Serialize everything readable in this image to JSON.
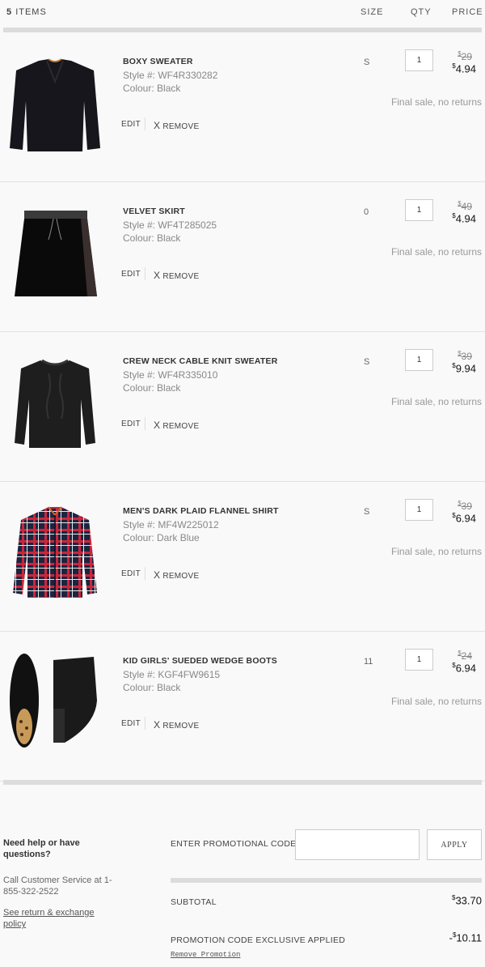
{
  "header": {
    "count": "5",
    "items_label": "ITEMS",
    "size_label": "SIZE",
    "qty_label": "QTY",
    "price_label": "PRICE"
  },
  "items": [
    {
      "name": "BOXY SWEATER",
      "style": "Style #:  WF4R330282",
      "colour": "Colour: Black",
      "size": "S",
      "qty": "1",
      "orig_price": "29",
      "sale_price": "4.94",
      "note": "Final sale, no returns",
      "edit": "EDIT",
      "remove": "REMOVE",
      "icon": "sweater-image"
    },
    {
      "name": "VELVET SKIRT",
      "style": "Style #:  WF4T285025",
      "colour": "Colour: Black",
      "size": "0",
      "qty": "1",
      "orig_price": "49",
      "sale_price": "4.94",
      "note": "Final sale, no returns",
      "edit": "EDIT",
      "remove": "REMOVE",
      "icon": "skirt-image"
    },
    {
      "name": "CREW NECK CABLE KNIT SWEATER",
      "style": "Style #:  WF4R335010",
      "colour": "Colour: Black",
      "size": "S",
      "qty": "1",
      "orig_price": "39",
      "sale_price": "9.94",
      "note": "Final sale, no returns",
      "edit": "EDIT",
      "remove": "REMOVE",
      "icon": "cable-sweater-image"
    },
    {
      "name": "MEN'S DARK PLAID FLANNEL SHIRT",
      "style": "Style #:  MF4W225012",
      "colour": "Colour: Dark Blue",
      "size": "S",
      "qty": "1",
      "orig_price": "39",
      "sale_price": "6.94",
      "note": "Final sale, no returns",
      "edit": "EDIT",
      "remove": "REMOVE",
      "icon": "plaid-shirt-image"
    },
    {
      "name": "KID GIRLS' SUEDED WEDGE BOOTS",
      "style": "Style #:  KGF4FW9615",
      "colour": "Colour: Black",
      "size": "11",
      "qty": "1",
      "orig_price": "24",
      "sale_price": "6.94",
      "note": "Final sale, no returns",
      "edit": "EDIT",
      "remove": "REMOVE",
      "icon": "boots-image"
    }
  ],
  "help": {
    "question": "Need help or have questions?",
    "call": "Call Customer Service at 1-855-322-2522",
    "policy": "See return & exchange policy"
  },
  "promo": {
    "label": "ENTER PROMOTIONAL CODE",
    "input_value": "",
    "apply": "APPLY"
  },
  "summary": {
    "subtotal_label": "SUBTOTAL",
    "subtotal_value": "33.70",
    "promo_applied_label": "PROMOTION CODE EXCLUSIVE APPLIED",
    "promo_sign": "-",
    "promo_value": "10.11",
    "remove_promo": "Remove Promotion",
    "currency": "$"
  }
}
